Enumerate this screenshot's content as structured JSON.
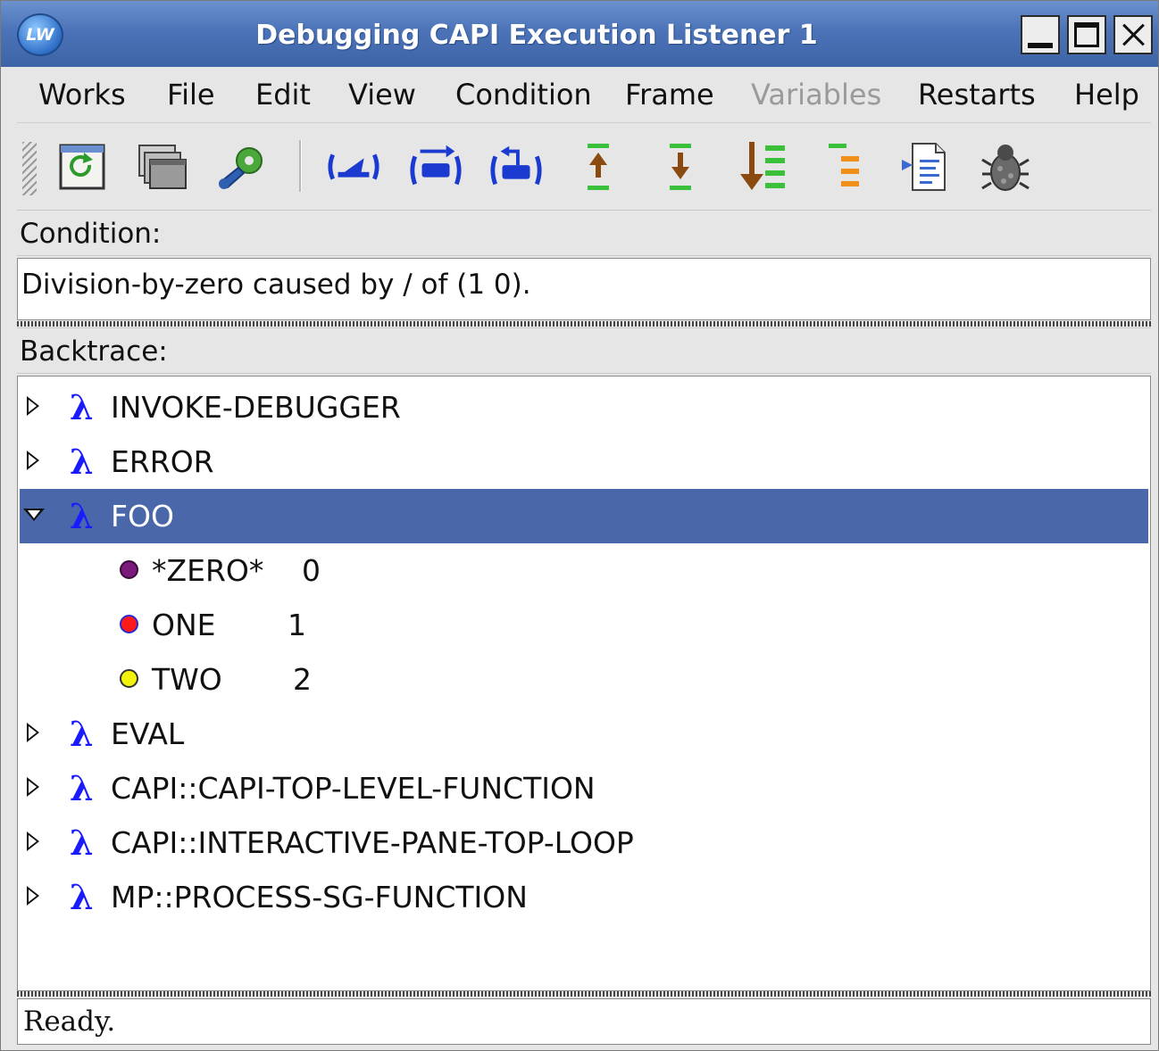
{
  "window": {
    "title": "Debugging CAPI Execution Listener 1",
    "app_icon_text": "LW"
  },
  "menu": [
    {
      "label": "Works",
      "enabled": true
    },
    {
      "label": "File",
      "enabled": true
    },
    {
      "label": "Edit",
      "enabled": true
    },
    {
      "label": "View",
      "enabled": true
    },
    {
      "label": "Condition",
      "enabled": true
    },
    {
      "label": "Frame",
      "enabled": true
    },
    {
      "label": "Variables",
      "enabled": false
    },
    {
      "label": "Restarts",
      "enabled": true
    },
    {
      "label": "Help",
      "enabled": true
    }
  ],
  "toolbar": {
    "buttons": [
      "refresh-icon",
      "windows-icon",
      "tools-icon",
      "abort-restart-icon",
      "continue-restart-icon",
      "return-from-frame-icon",
      "frame-up-icon",
      "frame-down-icon",
      "frame-bottom-icon",
      "frame-top-icon",
      "edit-source-icon",
      "debugger-bug-icon"
    ]
  },
  "condition": {
    "label": "Condition:",
    "text": "Division-by-zero caused by / of (1 0)."
  },
  "backtrace": {
    "label": "Backtrace:",
    "frames": [
      {
        "name": "INVOKE-DEBUGGER",
        "expanded": false,
        "selected": false
      },
      {
        "name": "ERROR",
        "expanded": false,
        "selected": false
      },
      {
        "name": "FOO",
        "expanded": true,
        "selected": true,
        "variables": [
          {
            "name": "*ZERO*",
            "value": "0",
            "color": "#7a1a7a"
          },
          {
            "name": "ONE",
            "value": "1",
            "color": "#ff1a1a"
          },
          {
            "name": "TWO",
            "value": "2",
            "color": "#f2f20a"
          }
        ]
      },
      {
        "name": "EVAL",
        "expanded": false,
        "selected": false
      },
      {
        "name": "CAPI::CAPI-TOP-LEVEL-FUNCTION",
        "expanded": false,
        "selected": false
      },
      {
        "name": "CAPI::INTERACTIVE-PANE-TOP-LOOP",
        "expanded": false,
        "selected": false
      },
      {
        "name": "MP::PROCESS-SG-FUNCTION",
        "expanded": false,
        "selected": false
      }
    ],
    "lambda_glyph": "λ"
  },
  "status": {
    "text": "Ready."
  },
  "colors": {
    "selection": "#4a67aa",
    "lambda": "#1a1aff",
    "title_bar": "#4c73b7"
  }
}
